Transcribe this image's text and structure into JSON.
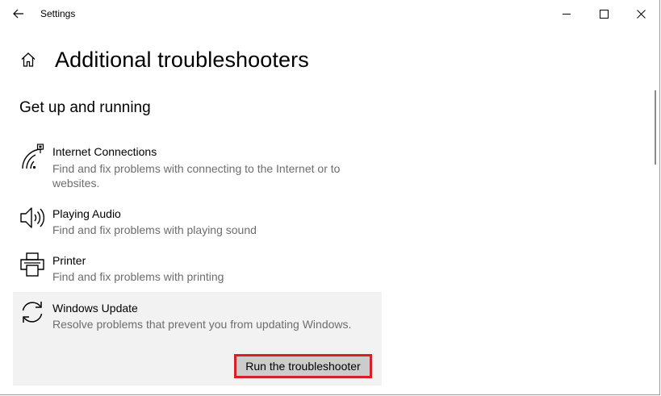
{
  "window": {
    "title": "Settings"
  },
  "header": {
    "title": "Additional troubleshooters"
  },
  "section": {
    "title": "Get up and running"
  },
  "items": [
    {
      "name": "Internet Connections",
      "description": "Find and fix problems with connecting to the Internet or to websites.",
      "icon": "wifi-network-icon"
    },
    {
      "name": "Playing Audio",
      "description": "Find and fix problems with playing sound",
      "icon": "speaker-icon"
    },
    {
      "name": "Printer",
      "description": "Find and fix problems with printing",
      "icon": "printer-icon"
    },
    {
      "name": "Windows Update",
      "description": "Resolve problems that prevent you from updating Windows.",
      "icon": "sync-icon",
      "selected": true
    }
  ],
  "run_button": {
    "label": "Run the troubleshooter"
  },
  "colors": {
    "selected_background": "#f2f2f2",
    "button_background": "#cccccc",
    "highlight_border": "#d4202b",
    "description_text": "#6d6d6d"
  }
}
